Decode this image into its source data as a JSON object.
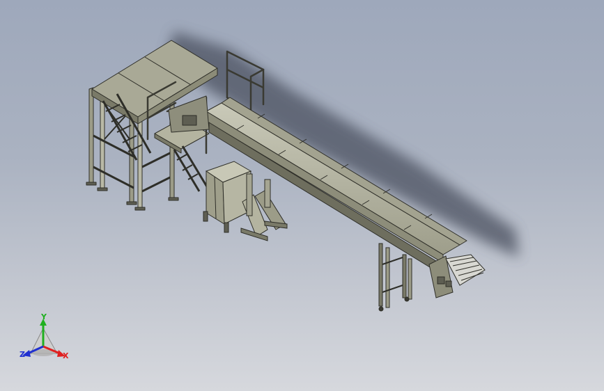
{
  "viewport": {
    "background_top": "#9ea8bb",
    "background_bottom": "#d6d8dd"
  },
  "model": {
    "colors": {
      "steel_light": "#b9b9a6",
      "steel_mid": "#9c9c88",
      "steel_dark": "#5e5e52",
      "edge": "#2e2e28",
      "shadow": "#4b5160",
      "roller": "#d8d8d2"
    },
    "parts": [
      "platform-structure",
      "platform-stairs",
      "platform-handrail",
      "collection-bin",
      "conveyor-support-frame",
      "inclined-belt-conveyor",
      "conveyor-leg-stand",
      "discharge-roller-chute"
    ]
  },
  "triad": {
    "labels": {
      "x": "X",
      "y": "Y",
      "z": "Z"
    },
    "colors": {
      "x": "#e02020",
      "y": "#20b020",
      "z": "#2030d0"
    }
  }
}
